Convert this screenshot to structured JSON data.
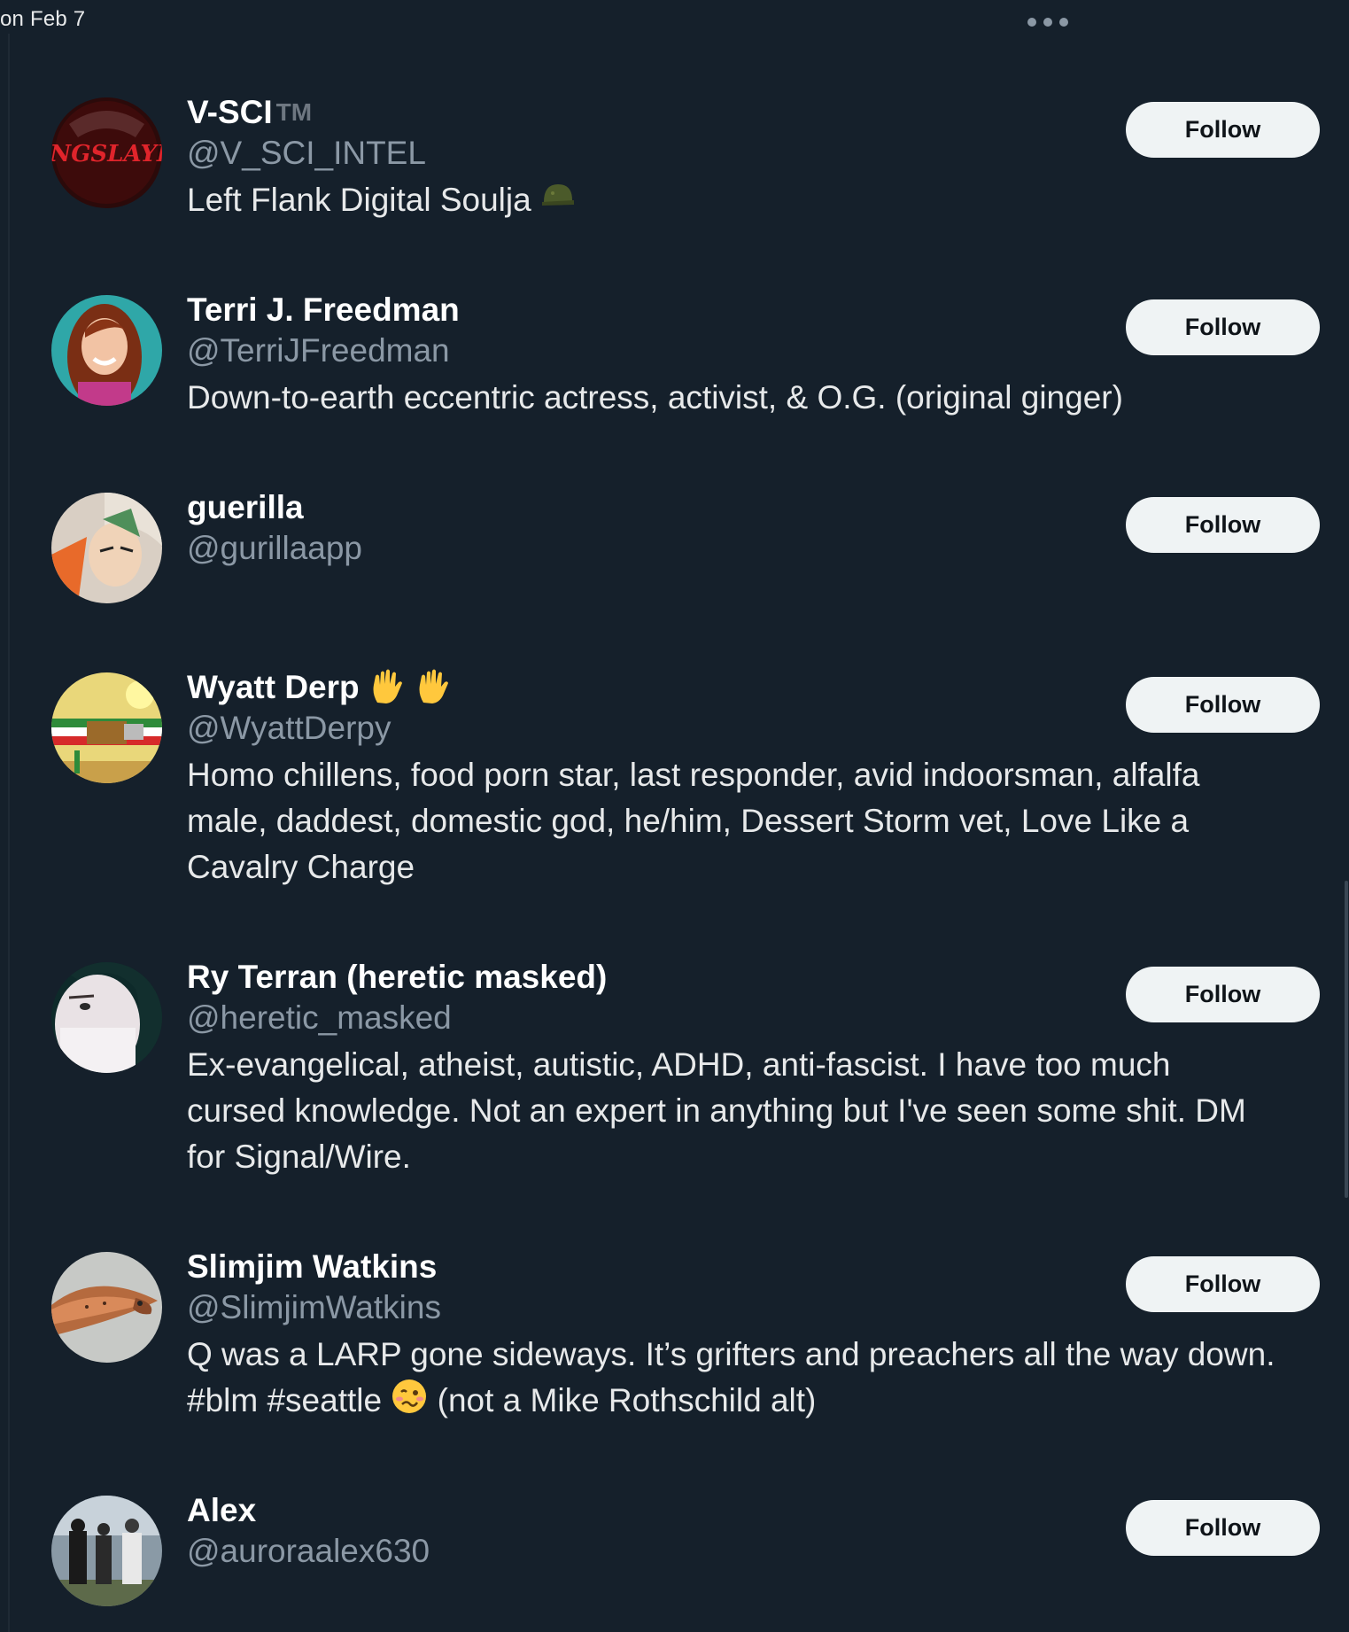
{
  "header": {
    "date_fragment": "on Feb 7",
    "more_icon": "more-horizontal-icon"
  },
  "follow_label": "Follow",
  "accounts": [
    {
      "name": "V-SCI",
      "name_suffix": "TM",
      "handle": "@V_SCI_INTEL",
      "bio_lines": [
        "Left Flank Digital Soulja"
      ],
      "bio_emoji": "helmet-icon",
      "avatar_text": "KINGSLAYER"
    },
    {
      "name": "Terri J. Freedman",
      "handle": "@TerriJFreedman",
      "bio_lines": [
        "Down-to-earth eccentric actress, activist, & O.G. (original ginger)"
      ]
    },
    {
      "name": "guerilla",
      "handle": "@gurillaapp",
      "bio_lines": []
    },
    {
      "name": "Wyatt Derp",
      "name_emoji": "raised-hand-icon",
      "handle": "@WyattDerpy",
      "bio_lines": [
        "Homo chillens, food porn star, last responder, avid indoorsman, alfalfa",
        "male, daddest, domestic god, he/him, Dessert Storm vet, Love Like a",
        "Cavalry Charge"
      ]
    },
    {
      "name": "Ry Terran (heretic masked)",
      "handle": "@heretic_masked",
      "bio_lines": [
        "Ex-evangelical, atheist, autistic, ADHD, anti-fascist. I have too much",
        "cursed knowledge. Not an expert in anything but I've seen some shit. DM",
        "for Signal/Wire."
      ]
    },
    {
      "name": "Slimjim Watkins",
      "handle": "@SlimjimWatkins",
      "bio_lines": [
        "Q was a LARP gone sideways. It’s grifters and preachers all the way down.",
        "#blm #seattle",
        "(not a Mike Rothschild alt)"
      ],
      "bio_emoji": "woozy-face-icon"
    },
    {
      "name": "Alex",
      "handle": "@auroraalex630",
      "bio_lines": []
    }
  ],
  "colors": {
    "background": "#15202b",
    "primary_text": "#e7e9ea",
    "secondary_text": "#8b98a5",
    "button_bg": "#eff3f4",
    "button_text": "#0f1419"
  }
}
